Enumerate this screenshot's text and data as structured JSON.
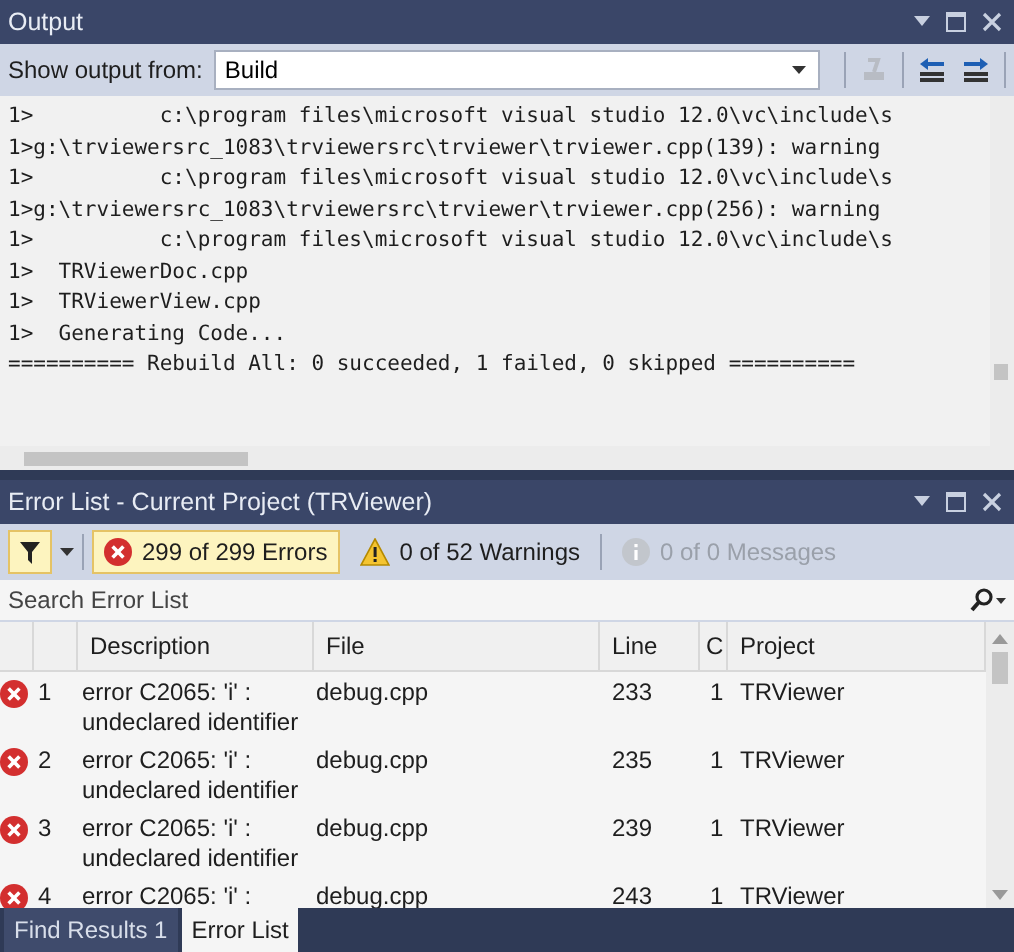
{
  "output_panel": {
    "title": "Output",
    "show_output_from_label": "Show output from:",
    "source": "Build",
    "lines": [
      "1>          c:\\program files\\microsoft visual studio 12.0\\vc\\include\\s",
      "1>g:\\trviewersrc_1083\\trviewersrc\\trviewer\\trviewer.cpp(139): warning",
      "1>          c:\\program files\\microsoft visual studio 12.0\\vc\\include\\s",
      "1>g:\\trviewersrc_1083\\trviewersrc\\trviewer\\trviewer.cpp(256): warning",
      "1>          c:\\program files\\microsoft visual studio 12.0\\vc\\include\\s",
      "1>  TRViewerDoc.cpp",
      "1>  TRViewerView.cpp",
      "1>  Generating Code...",
      "========== Rebuild All: 0 succeeded, 1 failed, 0 skipped =========="
    ]
  },
  "error_list": {
    "title": "Error List - Current Project (TRViewer)",
    "filters": [
      {
        "kind": "error",
        "label": "299 of 299 Errors",
        "selected": true,
        "disabled": false
      },
      {
        "kind": "warning",
        "label": "0 of 52 Warnings",
        "selected": false,
        "disabled": false
      },
      {
        "kind": "message",
        "label": "0 of 0 Messages",
        "selected": false,
        "disabled": true
      }
    ],
    "search": {
      "placeholder": "Search Error List"
    },
    "columns": [
      "Description",
      "File",
      "Line",
      "C",
      "Project"
    ],
    "rows": [
      {
        "num": "1",
        "description": "error C2065: 'i' : undeclared identifier",
        "file": "debug.cpp",
        "line": "233",
        "col": "1",
        "project": "TRViewer"
      },
      {
        "num": "2",
        "description": "error C2065: 'i' : undeclared identifier",
        "file": "debug.cpp",
        "line": "235",
        "col": "1",
        "project": "TRViewer"
      },
      {
        "num": "3",
        "description": "error C2065: 'i' : undeclared identifier",
        "file": "debug.cpp",
        "line": "239",
        "col": "1",
        "project": "TRViewer"
      },
      {
        "num": "4",
        "description": "error C2065: 'i' :",
        "file": "debug.cpp",
        "line": "243",
        "col": "1",
        "project": "TRViewer"
      }
    ]
  },
  "bottom_tabs": [
    {
      "label": "Find Results 1",
      "selected": false
    },
    {
      "label": "Error List",
      "selected": true
    }
  ]
}
